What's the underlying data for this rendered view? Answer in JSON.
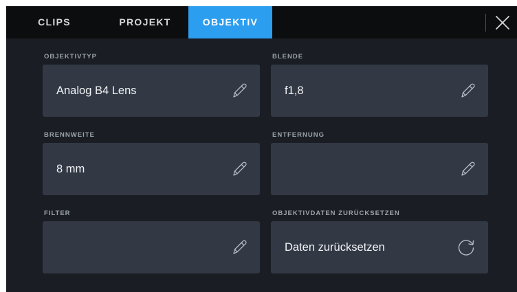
{
  "tabs": [
    {
      "label": "CLIPS",
      "active": false
    },
    {
      "label": "PROJEKT",
      "active": false
    },
    {
      "label": "OBJEKTIV",
      "active": true
    }
  ],
  "fields": {
    "lens_type": {
      "label": "OBJEKTIVTYP",
      "value": "Analog B4 Lens",
      "icon": "pencil-icon"
    },
    "aperture": {
      "label": "BLENDE",
      "value": "f1,8",
      "icon": "pencil-icon"
    },
    "focal_length": {
      "label": "BRENNWEITE",
      "value": "8 mm",
      "icon": "pencil-icon"
    },
    "distance": {
      "label": "ENTFERNUNG",
      "value": "",
      "icon": "pencil-icon"
    },
    "filter": {
      "label": "FILTER",
      "value": "",
      "icon": "pencil-icon"
    },
    "reset": {
      "label": "OBJEKTIVDATEN ZURÜCKSETZEN",
      "value": "Daten zurücksetzen",
      "icon": "refresh-icon"
    }
  },
  "colors": {
    "accent": "#2c9ef0",
    "tabbar": "#0c0d0f",
    "background": "#1a1e24",
    "field": "#323945",
    "label": "#9ca2aa",
    "text": "#f2f3f5"
  }
}
